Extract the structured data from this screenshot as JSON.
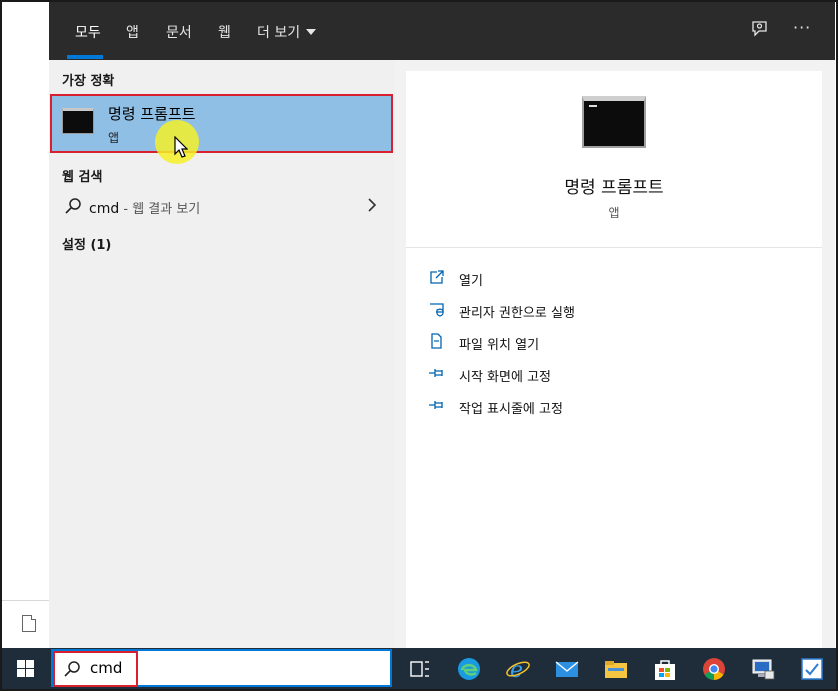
{
  "tabs": [
    {
      "label": "모두",
      "active": true
    },
    {
      "label": "앱"
    },
    {
      "label": "문서"
    },
    {
      "label": "웹"
    },
    {
      "label": "더 보기"
    }
  ],
  "top_icons": [
    "feedback-icon",
    "more-options-icon"
  ],
  "more_label": "···",
  "sections": {
    "best_match_title": "가장 정확",
    "web_search_title": "웹 검색",
    "settings_title": "설정 (1)"
  },
  "best_match": {
    "title": "명령 프롬프트",
    "subtitle": "앱"
  },
  "web_result": {
    "query": "cmd",
    "suffix": " - 웹 결과 보기"
  },
  "detail": {
    "title": "명령 프롬프트",
    "type": "앱",
    "actions": [
      {
        "label": "열기",
        "icon": "open-icon"
      },
      {
        "label": "관리자 권한으로 실행",
        "icon": "admin-shield-icon"
      },
      {
        "label": "파일 위치 열기",
        "icon": "file-location-icon"
      },
      {
        "label": "시작 화면에 고정",
        "icon": "pin-icon"
      },
      {
        "label": "작업 표시줄에 고정",
        "icon": "pin-icon"
      }
    ]
  },
  "search": {
    "value": "cmd"
  },
  "taskbar_icons": [
    "task-view-icon",
    "edge-icon",
    "ie-icon",
    "mail-icon",
    "file-explorer-icon",
    "store-icon",
    "chrome-icon",
    "network-icon",
    "app-icon"
  ],
  "colors": {
    "accent": "#0078d7",
    "highlight": "#90bfe6",
    "selection_border": "#d9202f",
    "taskbar": "#1f2c3a",
    "topbar": "#2b2b2b"
  }
}
